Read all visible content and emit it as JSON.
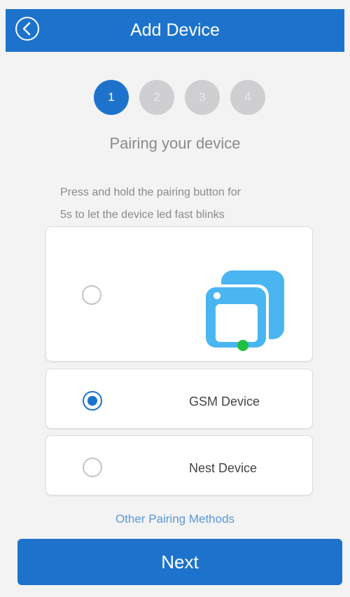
{
  "header": {
    "title": "Add Device",
    "back_icon": "chevron-left-circle-icon"
  },
  "steps": {
    "current": 1,
    "items": [
      "1",
      "2",
      "3",
      "4"
    ]
  },
  "step_title": "Pairing your device",
  "instruction": {
    "line1": "Press and hold the pairing button for",
    "line2": "5s to let the device led fast blinks"
  },
  "options": [
    {
      "label": "",
      "icon": "device-blinking-led-icon",
      "selected": false
    },
    {
      "label": "GSM Device",
      "selected": true
    },
    {
      "label": "Nest Device",
      "selected": false
    }
  ],
  "other_link": "Other Pairing Methods",
  "next_button": "Next",
  "colors": {
    "primary": "#1d73cc",
    "illustration": "#4ab6f1",
    "led": "#1ec043",
    "step_inactive": "#cfcfd1"
  }
}
